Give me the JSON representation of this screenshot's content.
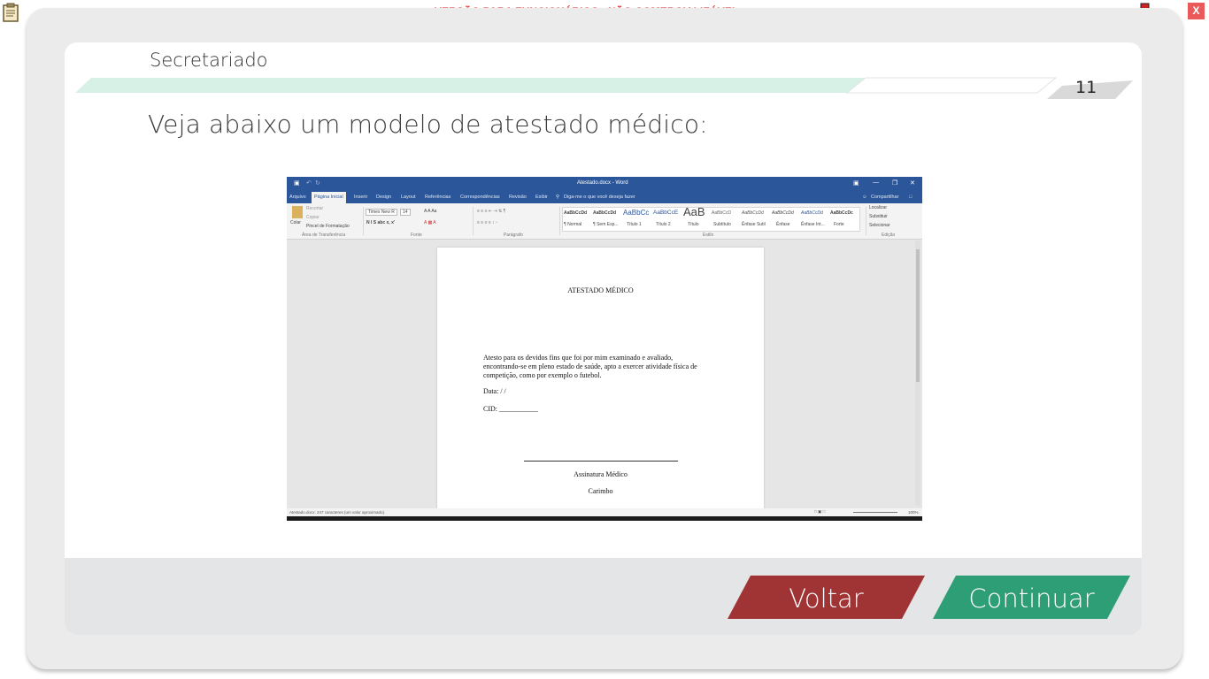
{
  "banner": {
    "text": "VERSÃO PARA FUNCIONÁRIOS - NÃO COMERCIALIZÁVEL",
    "close_label": "X"
  },
  "header": {
    "section": "Secretariado",
    "page_number": "11"
  },
  "main": {
    "heading": "Veja abaixo um modelo de atestado médico:"
  },
  "word": {
    "title": "Atestado.docx - Word",
    "tabs": [
      "Arquivo",
      "Página Inicial",
      "Inserir",
      "Design",
      "Layout",
      "Referências",
      "Correspondências",
      "Revisão",
      "Exibir"
    ],
    "tell_me": "Diga-me o que você deseja fazer",
    "share": "Compartilhar",
    "clipboard": {
      "paste": "Colar",
      "cut": "Recortar",
      "copy": "Copiar",
      "format_painter": "Pincel de Formatação",
      "group": "Área de Transferência"
    },
    "font": {
      "name": "Times New R",
      "size": "14",
      "group": "Fonte"
    },
    "paragraph_group": "Parágrafo",
    "styles": {
      "previews": [
        "AaBbCcDd",
        "AaBbCcDd",
        "AaBbCc",
        "AaBbCcE",
        "AaB",
        "AaBbCcD",
        "AaBbCcDd",
        "AaBbCcDd",
        "AaBbCcDd",
        "AaBbCcDc"
      ],
      "names": [
        "¶ Normal",
        "¶ Sem Esp...",
        "Título 1",
        "Título 2",
        "Título",
        "Subtítulo",
        "Ênfase Sutil",
        "Ênfase",
        "Ênfase Int...",
        "Forte"
      ],
      "group": "Estilo"
    },
    "editing": {
      "find": "Localizar",
      "replace": "Substituir",
      "select": "Selecionar",
      "group": "Edição"
    },
    "document": {
      "title": "ATESTADO MÉDICO",
      "body_lines": [
        "Atesto para os devidos fins que foi por mim examinado e avaliado,",
        "encontrando-se em pleno estado de saúde, apto a exercer atividade física de",
        "competição, como por exemplo o futebol."
      ],
      "date": "Data:   /   /",
      "cid": "CID: ___________",
      "signature": "Assinatura Médico",
      "stamp": "Carimbo"
    },
    "status": "Atestado.docx: 247 caracteres (um valor aproximado).",
    "zoom": "100%"
  },
  "nav": {
    "back": "Voltar",
    "next": "Continuar"
  },
  "colors": {
    "back": "#a03333",
    "next": "#2e9e76",
    "banner_text": "#e02828",
    "word_blue": "#2b579a"
  }
}
